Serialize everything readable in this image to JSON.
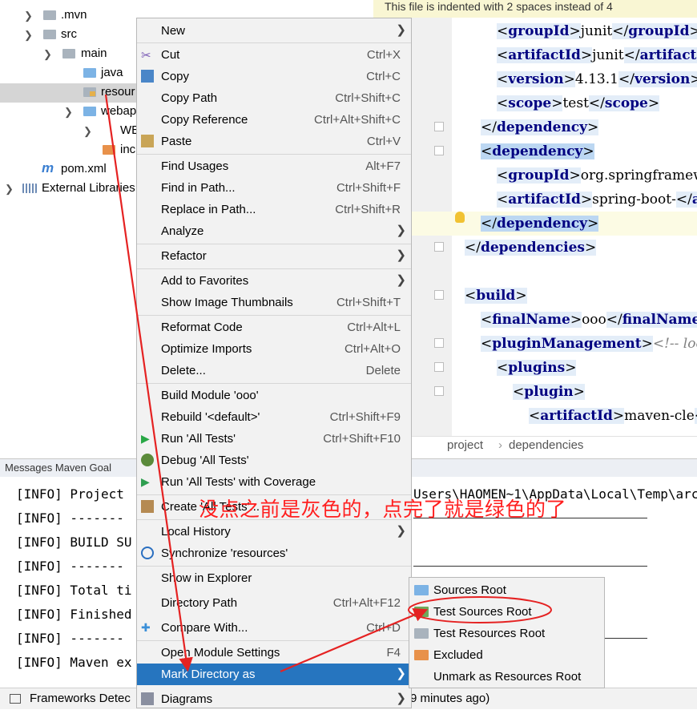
{
  "tree": {
    "items": [
      {
        "label": ".mvn"
      },
      {
        "label": "src"
      },
      {
        "label": "main"
      },
      {
        "label": "java"
      },
      {
        "label": "resour"
      },
      {
        "label": "webap"
      },
      {
        "label": "WE"
      },
      {
        "label": "inc"
      },
      {
        "label": "pom.xml"
      },
      {
        "label": "External Libraries"
      }
    ]
  },
  "editor": {
    "banner": "This file is indented with 2 spaces instead of 4",
    "lines": [
      {
        "tag": "groupId",
        "text": "junit"
      },
      {
        "tag": "artifactId",
        "text": "junit"
      },
      {
        "tag": "version",
        "text": "4.13.1"
      },
      {
        "tag": "scope",
        "text": "test"
      },
      {
        "tag": "dependency"
      },
      {
        "tag": "dependency"
      },
      {
        "tag": "groupId",
        "text": "org.springframew"
      },
      {
        "tag": "artifactId",
        "text": "spring-boot-"
      },
      {
        "tag": "dependency"
      },
      {
        "tag": "dependencies"
      },
      {
        "tag": "build"
      },
      {
        "tag": "finalName",
        "text": "ooo"
      },
      {
        "tag": "pluginManagement",
        "comment": "<!-- loc"
      },
      {
        "tag": "plugins"
      },
      {
        "tag": "plugin"
      },
      {
        "tag": "artifactId",
        "text": "maven-cle"
      }
    ],
    "breadcrumb": [
      "project",
      "dependencies"
    ]
  },
  "messages": {
    "header": "Messages Maven Goal",
    "lines": [
      "[INFO] Project",
      "[INFO] -------",
      "[INFO] BUILD SU",
      "[INFO] -------",
      "[INFO] Total ti",
      "[INFO] Finished",
      "[INFO] -------",
      "[INFO] Maven ex"
    ],
    "path_fragment": "Users\\HAOMEN~1\\AppData\\Local\\Temp\\arc"
  },
  "statusbar": {
    "left": "Frameworks Detec",
    "right": "9 minutes ago)"
  },
  "context_menu": {
    "items": [
      {
        "label": "New",
        "shortcut": "",
        "submenu": true
      },
      {
        "label": "Cut",
        "shortcut": "Ctrl+X"
      },
      {
        "label": "Copy",
        "shortcut": "Ctrl+C"
      },
      {
        "label": "Copy Path",
        "shortcut": "Ctrl+Shift+C"
      },
      {
        "label": "Copy Reference",
        "shortcut": "Ctrl+Alt+Shift+C"
      },
      {
        "label": "Paste",
        "shortcut": "Ctrl+V"
      },
      {
        "label": "Find Usages",
        "shortcut": "Alt+F7"
      },
      {
        "label": "Find in Path...",
        "shortcut": "Ctrl+Shift+F"
      },
      {
        "label": "Replace in Path...",
        "shortcut": "Ctrl+Shift+R"
      },
      {
        "label": "Analyze",
        "shortcut": "",
        "submenu": true
      },
      {
        "label": "Refactor",
        "shortcut": "",
        "submenu": true
      },
      {
        "label": "Add to Favorites",
        "shortcut": "",
        "submenu": true
      },
      {
        "label": "Show Image Thumbnails",
        "shortcut": "Ctrl+Shift+T"
      },
      {
        "label": "Reformat Code",
        "shortcut": "Ctrl+Alt+L"
      },
      {
        "label": "Optimize Imports",
        "shortcut": "Ctrl+Alt+O"
      },
      {
        "label": "Delete...",
        "shortcut": "Delete"
      },
      {
        "label": "Build Module 'ooo'",
        "shortcut": ""
      },
      {
        "label": "Rebuild '<default>'",
        "shortcut": "Ctrl+Shift+F9"
      },
      {
        "label": "Run 'All Tests'",
        "shortcut": "Ctrl+Shift+F10"
      },
      {
        "label": "Debug 'All Tests'",
        "shortcut": ""
      },
      {
        "label": "Run 'All Tests' with Coverage",
        "shortcut": ""
      },
      {
        "label": "Create 'All Tests'...",
        "shortcut": ""
      },
      {
        "label": "Local History",
        "shortcut": "",
        "submenu": true
      },
      {
        "label": "Synchronize 'resources'",
        "shortcut": ""
      },
      {
        "label": "Show in Explorer",
        "shortcut": ""
      },
      {
        "label": "Directory Path",
        "shortcut": "Ctrl+Alt+F12"
      },
      {
        "label": "Compare With...",
        "shortcut": "Ctrl+D"
      },
      {
        "label": "Open Module Settings",
        "shortcut": "F4"
      },
      {
        "label": "Mark Directory as",
        "shortcut": "",
        "submenu": true,
        "active": true
      },
      {
        "label": "Diagrams",
        "shortcut": "",
        "submenu": true
      }
    ]
  },
  "submenu": {
    "items": [
      {
        "label": "Sources Root"
      },
      {
        "label": "Test Sources Root"
      },
      {
        "label": "Test Resources Root"
      },
      {
        "label": "Excluded"
      },
      {
        "label": "Unmark as Resources Root"
      }
    ]
  },
  "annotation": {
    "text": "没点之前是灰色的，点完了就是绿色的了"
  },
  "colors": {
    "menu_highlight": "#2675bf",
    "annotation": "#ff1f1f",
    "xml_tag": "#000080",
    "test_sources_icon": "#6fa85a",
    "sources_icon": "#7cb3e5",
    "excluded_icon": "#e8914a"
  }
}
